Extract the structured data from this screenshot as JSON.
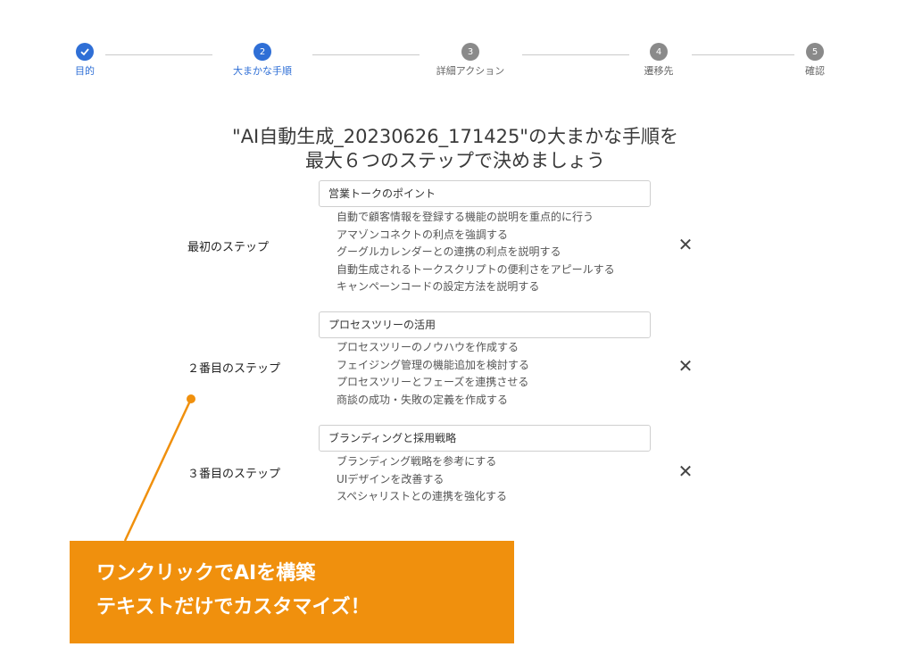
{
  "stepper": {
    "steps": [
      {
        "number": "✓",
        "label": "目的",
        "state": "done"
      },
      {
        "number": "2",
        "label": "大まかな手順",
        "state": "active"
      },
      {
        "number": "3",
        "label": "詳細アクション",
        "state": "todo"
      },
      {
        "number": "4",
        "label": "遷移先",
        "state": "todo"
      },
      {
        "number": "5",
        "label": "確認",
        "state": "todo"
      }
    ]
  },
  "heading": {
    "line1": "\"AI自動生成_20230626_171425\"の大まかな手順を",
    "line2": "最大６つのステップで決めましょう"
  },
  "blocks": [
    {
      "step_name": "最初のステップ",
      "title": "営業トークのポイント",
      "actions": [
        "自動で顧客情報を登録する機能の説明を重点的に行う",
        "アマゾンコネクトの利点を強調する",
        "グーグルカレンダーとの連携の利点を説明する",
        "自動生成されるトークスクリプトの便利さをアピールする",
        "キャンペーンコードの設定方法を説明する"
      ],
      "remove": "✕"
    },
    {
      "step_name": "２番目のステップ",
      "title": "プロセスツリーの活用",
      "actions": [
        "プロセスツリーのノウハウを作成する",
        "フェイジング管理の機能追加を検討する",
        "プロセスツリーとフェーズを連携させる",
        "商談の成功・失敗の定義を作成する"
      ],
      "remove": "✕"
    },
    {
      "step_name": "３番目のステップ",
      "title": "ブランディングと採用戦略",
      "actions": [
        "ブランディング戦略を参考にする",
        "UIデザインを改善する",
        "スペシャリストとの連携を強化する"
      ],
      "remove": "✕"
    }
  ],
  "callout": {
    "line1": "ワンクリックでAIを構築",
    "line2": "テキストだけでカスタマイズ！",
    "color": "#f0900d"
  },
  "colors": {
    "accent": "#2f6fd6",
    "inactive": "#8a8a8a"
  }
}
